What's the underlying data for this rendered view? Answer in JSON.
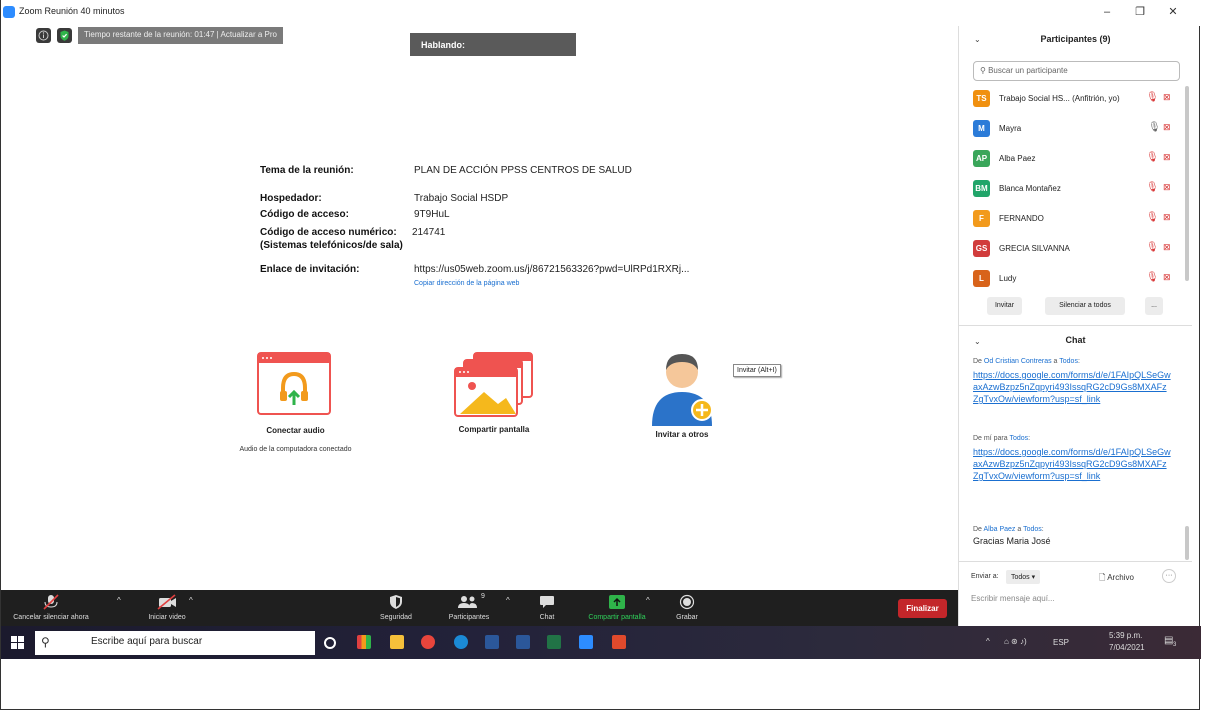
{
  "window": {
    "title": "Zoom Reunión 40 minutos",
    "minimize": "–",
    "maximize": "❐",
    "close": "✕"
  },
  "meeting": {
    "timer": "Tiempo restante de la reunión: 01:47 | Actualizar a Pro",
    "speaking": "Hablando:",
    "info": {
      "topic_label": "Tema de la reunión:",
      "topic": "PLAN DE ACCIÓN PPSS CENTROS DE SALUD",
      "host_label": "Hospedador:",
      "host": "Trabajo Social HSDP",
      "code_label": "Código de acceso:",
      "code": "9T9HuL",
      "numcode_label": "Código de acceso numérico:",
      "numcode": "214741",
      "numcode_label2": "(Sistemas telefónicos/de sala)",
      "link_label": "Enlace de invitación:",
      "link": "https://us05web.zoom.us/j/86721563326?pwd=UlRPd1RXRj...",
      "copy_link": "Copiar dirección de la página web"
    },
    "actions": {
      "audio": "Conectar audio",
      "audio_sub": "Audio de la computadora conectado",
      "share": "Compartir pantalla",
      "invite": "Invitar a otros",
      "invite_tooltip": "Invitar (Alt+I)"
    }
  },
  "toolbar": {
    "mute": "Cancelar silenciar ahora",
    "video": "Iniciar video",
    "security": "Seguridad",
    "participants": "Participantes",
    "participants_count": "9",
    "chat": "Chat",
    "share": "Compartir pantalla",
    "record": "Grabar",
    "end": "Finalizar"
  },
  "participants_panel": {
    "title": "Participantes (9)",
    "search_placeholder": "Buscar un participante",
    "list": [
      {
        "initials": "TS",
        "name": "Trabajo Social HS... (Anfitrión, yo)",
        "color": "#f0900f",
        "mic": "off"
      },
      {
        "initials": "M",
        "name": "Mayra",
        "color": "#2b7bd8",
        "mic": "on"
      },
      {
        "initials": "AP",
        "name": "Alba Paez",
        "color": "#3aa65a",
        "mic": "off"
      },
      {
        "initials": "BM",
        "name": "Blanca Montañez",
        "color": "#21a56a",
        "mic": "off"
      },
      {
        "initials": "F",
        "name": "FERNANDO",
        "color": "#f29a1c",
        "mic": "off"
      },
      {
        "initials": "GS",
        "name": "GRECIA SILVANNA",
        "color": "#d13c3c",
        "mic": "off"
      },
      {
        "initials": "L",
        "name": "Ludy",
        "color": "#d8631a",
        "mic": "off"
      }
    ],
    "invite": "Invitar",
    "mute_all": "Silenciar a todos",
    "more": "..."
  },
  "chat_panel": {
    "title": "Chat",
    "messages": [
      {
        "prefix": "De ",
        "sender": "Od Cristian Contreras",
        "mid": " a ",
        "to": "Todos",
        "suffix": ":",
        "text": "https://docs.google.com/forms/d/e/1FAIpQLSeGwaxAzwBzpz5nZqpyri493IssqRG2cD9Gs8MXAFzZgTvxOw/viewform?usp=sf_link",
        "is_link": true
      },
      {
        "prefix": "De mí para ",
        "sender": "",
        "mid": "",
        "to": "Todos",
        "suffix": ":",
        "text": "https://docs.google.com/forms/d/e/1FAIpQLSeGwaxAzwBzpz5nZqpyri493IssqRG2cD9Gs8MXAFzZgTvxOw/viewform?usp=sf_link",
        "is_link": true
      },
      {
        "prefix": "De ",
        "sender": "Alba Paez",
        "mid": " a ",
        "to": "Todos",
        "suffix": ":",
        "text": "Gracias Maria José",
        "is_link": false
      }
    ],
    "send_to_label": "Enviar a:",
    "send_to_value": "Todos",
    "file": "Archivo",
    "more": "···",
    "placeholder": "Escribir mensaje aquí..."
  },
  "taskbar": {
    "search": "Escribe aquí para buscar",
    "lang": "ESP",
    "time": "5:39 p.m.",
    "date": "7/04/2021",
    "notif": "3"
  }
}
